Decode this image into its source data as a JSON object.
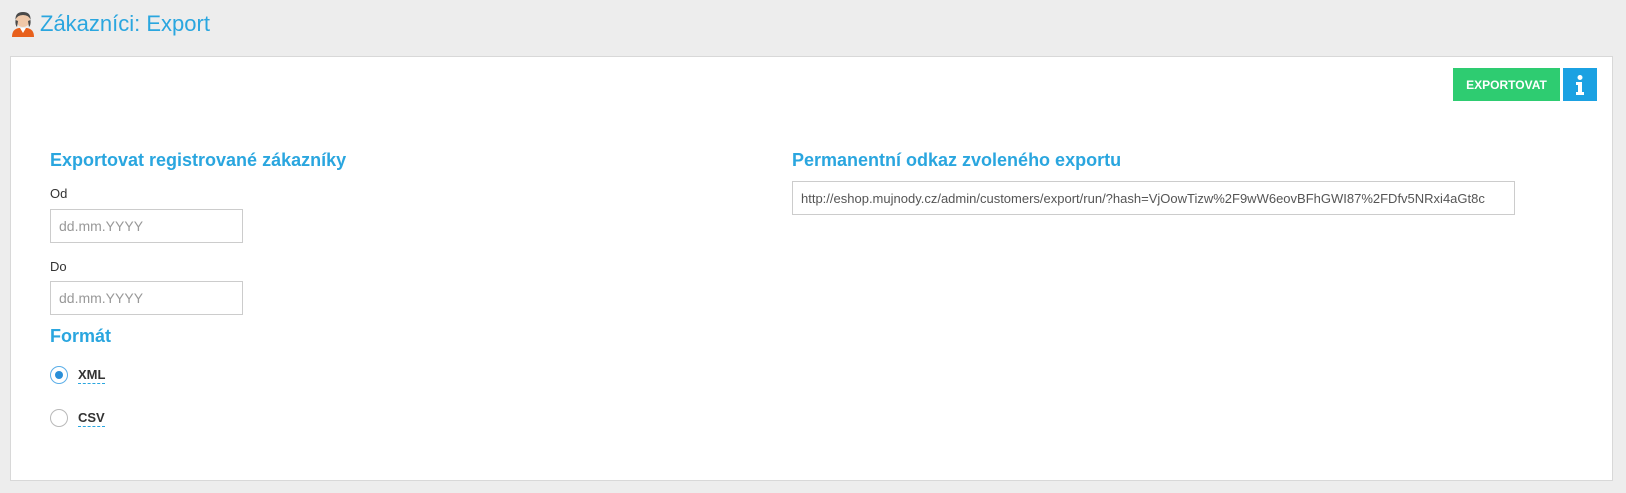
{
  "header": {
    "title": "Zákazníci: Export"
  },
  "toolbar": {
    "export_label": "EXPORTOVAT",
    "info_icon": "info-icon"
  },
  "left": {
    "section_title": "Exportovat registrované zákazníky",
    "from_label": "Od",
    "from_placeholder": "dd.mm.YYYY",
    "to_label": "Do",
    "to_placeholder": "dd.mm.YYYY",
    "format_title": "Formát",
    "formats": [
      {
        "label": "XML",
        "checked": true
      },
      {
        "label": "CSV",
        "checked": false
      }
    ]
  },
  "right": {
    "section_title": "Permanentní odkaz zvoleného exportu",
    "link_value": "http://eshop.mujnody.cz/admin/customers/export/run/?hash=VjOowTizw%2F9wW6eovBFhGWI87%2FDfv5NRxi4aGt8c"
  },
  "colors": {
    "accent": "#2aa6df",
    "export_button": "#2ecc71",
    "info_button": "#1ba1e2"
  }
}
